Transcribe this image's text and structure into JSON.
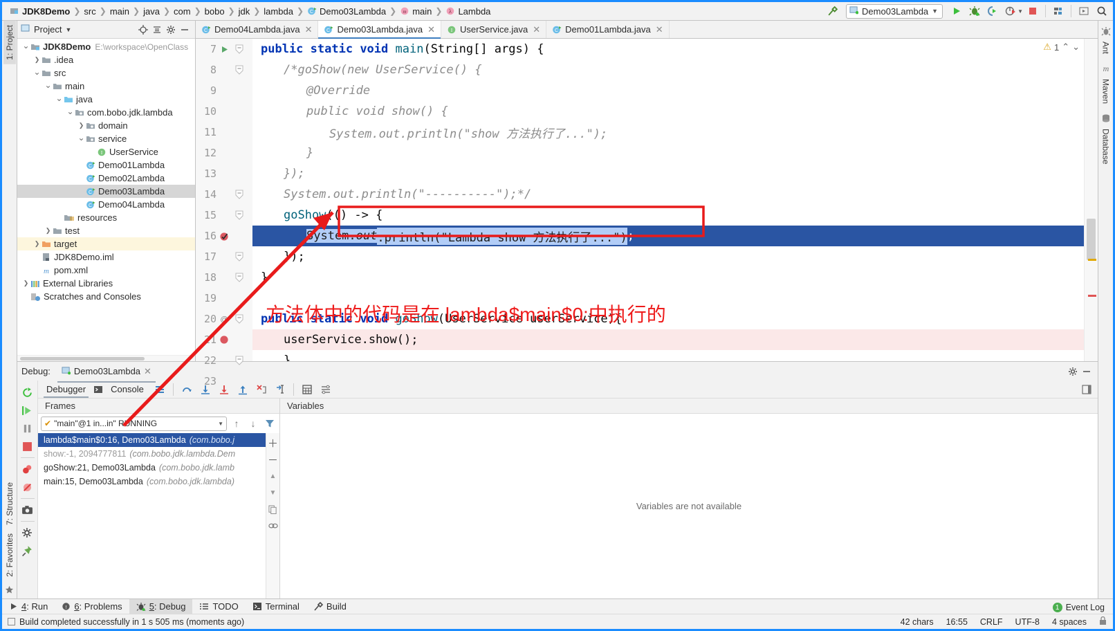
{
  "window": {
    "accent": "#1a8cff"
  },
  "breadcrumb": {
    "items": [
      {
        "label": "JDK8Demo",
        "icon": "project-icon",
        "bold": true
      },
      {
        "label": "src",
        "icon": ""
      },
      {
        "label": "main",
        "icon": ""
      },
      {
        "label": "java",
        "icon": ""
      },
      {
        "label": "com",
        "icon": ""
      },
      {
        "label": "bobo",
        "icon": ""
      },
      {
        "label": "jdk",
        "icon": ""
      },
      {
        "label": "lambda",
        "icon": ""
      },
      {
        "label": "Demo03Lambda",
        "icon": "class-icon"
      },
      {
        "label": "main",
        "icon": "method-icon"
      },
      {
        "label": "Lambda",
        "icon": "lambda-icon"
      }
    ]
  },
  "toolbar": {
    "build_label": "build-hammer-icon",
    "run_config": "Demo03Lambda",
    "run_label": "run-icon",
    "debug_label": "debug-icon",
    "run_coverage_label": "run-with-coverage-icon",
    "profiler_label": "profiler-icon",
    "stop_label": "stop-icon",
    "structure_label": "app-structure-icon",
    "updates_label": "updates-icon",
    "search_label": "search-icon"
  },
  "left_rail": {
    "top": [
      {
        "label": "1: Project",
        "selected": true
      }
    ],
    "bottom": [
      {
        "label": "7: Structure"
      },
      {
        "label": "2: Favorites"
      }
    ]
  },
  "right_rail": {
    "items": [
      {
        "label": "Ant",
        "icon": "ant-icon"
      },
      {
        "label": "Maven",
        "icon": "maven-icon"
      },
      {
        "label": "Database",
        "icon": "database-icon"
      }
    ]
  },
  "project_panel": {
    "title": "Project",
    "tree": [
      {
        "indent": 0,
        "arrow": "v",
        "icon": "module-icon",
        "label": "JDK8Demo",
        "bold": true,
        "path": "E:\\workspace\\OpenClass"
      },
      {
        "indent": 1,
        "arrow": ">",
        "icon": "folder-icon",
        "label": ".idea"
      },
      {
        "indent": 1,
        "arrow": "v",
        "icon": "folder-icon",
        "label": "src"
      },
      {
        "indent": 2,
        "arrow": "v",
        "icon": "folder-icon",
        "label": "main"
      },
      {
        "indent": 3,
        "arrow": "v",
        "icon": "source-folder-icon",
        "label": "java"
      },
      {
        "indent": 4,
        "arrow": "v",
        "icon": "package-icon",
        "label": "com.bobo.jdk.lambda"
      },
      {
        "indent": 5,
        "arrow": ">",
        "icon": "package-icon",
        "label": "domain"
      },
      {
        "indent": 5,
        "arrow": "v",
        "icon": "package-icon",
        "label": "service"
      },
      {
        "indent": 6,
        "arrow": "",
        "icon": "interface-icon",
        "label": "UserService"
      },
      {
        "indent": 5,
        "arrow": "",
        "icon": "class-icon",
        "label": "Demo01Lambda"
      },
      {
        "indent": 5,
        "arrow": "",
        "icon": "class-icon",
        "label": "Demo02Lambda"
      },
      {
        "indent": 5,
        "arrow": "",
        "icon": "class-icon",
        "label": "Demo03Lambda",
        "selected": true
      },
      {
        "indent": 5,
        "arrow": "",
        "icon": "class-icon",
        "label": "Demo04Lambda"
      },
      {
        "indent": 3,
        "arrow": "",
        "icon": "resources-folder-icon",
        "label": "resources"
      },
      {
        "indent": 2,
        "arrow": ">",
        "icon": "folder-icon",
        "label": "test"
      },
      {
        "indent": 1,
        "arrow": ">",
        "icon": "target-folder-icon",
        "label": "target",
        "highlight": true
      },
      {
        "indent": 1,
        "arrow": "",
        "icon": "iml-file-icon",
        "label": "JDK8Demo.iml"
      },
      {
        "indent": 1,
        "arrow": "",
        "icon": "maven-file-icon",
        "label": "pom.xml"
      },
      {
        "indent": 0,
        "arrow": ">",
        "icon": "libraries-icon",
        "label": "External Libraries"
      },
      {
        "indent": 0,
        "arrow": "",
        "icon": "scratches-icon",
        "label": "Scratches and Consoles"
      }
    ]
  },
  "editor": {
    "tabs": [
      {
        "label": "Demo04Lambda.java",
        "icon": "class-icon",
        "active": false
      },
      {
        "label": "Demo03Lambda.java",
        "icon": "class-icon",
        "active": true
      },
      {
        "label": "UserService.java",
        "icon": "interface-icon",
        "active": false
      },
      {
        "label": "Demo01Lambda.java",
        "icon": "class-icon",
        "active": false
      }
    ],
    "inspection_count": "1",
    "lines": [
      {
        "num": "7",
        "gutter": "run-gutter-icon",
        "fold": "-",
        "indent": 0,
        "tokens": [
          {
            "t": "public ",
            "c": "k"
          },
          {
            "t": "static ",
            "c": "k"
          },
          {
            "t": "void ",
            "c": "k"
          },
          {
            "t": "main",
            "c": "mth"
          },
          {
            "t": "(String[] args) {",
            "c": "plain"
          }
        ]
      },
      {
        "num": "8",
        "gutter": "",
        "fold": "-",
        "indent": 1,
        "tokens": [
          {
            "t": "/*goShow(new UserService() {",
            "c": "cmt"
          }
        ]
      },
      {
        "num": "9",
        "gutter": "",
        "fold": "",
        "indent": 2,
        "tokens": [
          {
            "t": "@Override",
            "c": "cmt"
          }
        ]
      },
      {
        "num": "10",
        "gutter": "",
        "fold": "",
        "indent": 2,
        "tokens": [
          {
            "t": "public void show() {",
            "c": "cmt"
          }
        ]
      },
      {
        "num": "11",
        "gutter": "",
        "fold": "",
        "indent": 3,
        "tokens": [
          {
            "t": "System.out.println(\"show 方法执行了...\");",
            "c": "cmt"
          }
        ]
      },
      {
        "num": "12",
        "gutter": "",
        "fold": "",
        "indent": 2,
        "tokens": [
          {
            "t": "}",
            "c": "cmt"
          }
        ]
      },
      {
        "num": "13",
        "gutter": "",
        "fold": "",
        "indent": 1,
        "tokens": [
          {
            "t": "});",
            "c": "cmt"
          }
        ]
      },
      {
        "num": "14",
        "gutter": "",
        "fold": "-",
        "indent": 1,
        "tokens": [
          {
            "t": "System.out.println(\"----------\");*/",
            "c": "cmt"
          }
        ]
      },
      {
        "num": "15",
        "gutter": "",
        "fold": "-",
        "indent": 1,
        "tokens": [
          {
            "t": "goShow",
            "c": "mth"
          },
          {
            "t": "(() -> {",
            "c": "plain"
          }
        ]
      },
      {
        "num": "16",
        "gutter": "breakpoint-done-icon",
        "fold": "",
        "indent": 2,
        "exec": true,
        "bulb": true,
        "tokens": [
          {
            "t": "System.",
            "c": "sel-txt"
          },
          {
            "t": "out",
            "c": "sel-txt i"
          },
          {
            "t": ".println(\"Lambda show 方法执行了...\")",
            "c": "sel-txt"
          },
          {
            "t": ";",
            "c": "caret"
          }
        ]
      },
      {
        "num": "17",
        "gutter": "",
        "fold": "-",
        "indent": 1,
        "tokens": [
          {
            "t": "});",
            "c": "plain"
          }
        ]
      },
      {
        "num": "18",
        "gutter": "",
        "fold": "-",
        "indent": 0,
        "tokens": [
          {
            "t": "}",
            "c": "plain"
          }
        ]
      },
      {
        "num": "19",
        "gutter": "",
        "fold": "",
        "indent": 0,
        "tokens": []
      },
      {
        "num": "20",
        "gutter": "usage-icon",
        "fold": "-",
        "indent": 0,
        "tokens": [
          {
            "t": "public ",
            "c": "k"
          },
          {
            "t": "static ",
            "c": "k"
          },
          {
            "t": "void ",
            "c": "k"
          },
          {
            "t": "goShow",
            "c": "mth"
          },
          {
            "t": "(UserService userService){",
            "c": "plain"
          }
        ]
      },
      {
        "num": "21",
        "gutter": "breakpoint-icon",
        "fold": "",
        "indent": 1,
        "bpline": true,
        "tokens": [
          {
            "t": "userService.show();",
            "c": "plain"
          }
        ]
      },
      {
        "num": "22",
        "gutter": "",
        "fold": "-",
        "indent": 1,
        "tokens": [
          {
            "t": "}",
            "c": "plain"
          }
        ]
      },
      {
        "num": "23",
        "gutter": "",
        "fold": "",
        "indent": 0,
        "tokens": [
          {
            "t": "}",
            "c": "plain"
          }
        ]
      }
    ]
  },
  "annotation": {
    "text": "方法体中的代码是在 lambda$main$0:中执行的",
    "color": "#ee1c1c"
  },
  "debug_panel": {
    "label": "Debug:",
    "session": "Demo03Lambda",
    "tabs": [
      {
        "label": "Debugger",
        "icon": "debugger-icon",
        "active": true
      },
      {
        "label": "Console",
        "icon": "console-icon",
        "active": false
      }
    ],
    "frames": {
      "title": "Frames",
      "thread": "\"main\"@1 in...in\" RUNNING",
      "items": [
        {
          "label": "lambda$main$0:16, Demo03Lambda",
          "pkg": "(com.bobo.j",
          "selected": true
        },
        {
          "label": "show:-1, 2094777811",
          "pkg": "(com.bobo.jdk.lambda.Dem",
          "dim": true
        },
        {
          "label": "goShow:21, Demo03Lambda",
          "pkg": "(com.bobo.jdk.lamb"
        },
        {
          "label": "main:15, Demo03Lambda",
          "pkg": "(com.bobo.jdk.lambda)"
        }
      ]
    },
    "variables": {
      "title": "Variables",
      "empty_message": "Variables are not available"
    }
  },
  "bottom_bar": {
    "items": [
      {
        "label": "4: Run",
        "mnemonic": "4",
        "icon": "run-icon",
        "selected": false
      },
      {
        "label": "6: Problems",
        "mnemonic": "6",
        "icon": "problems-icon",
        "selected": false
      },
      {
        "label": "5: Debug",
        "mnemonic": "5",
        "icon": "debug-icon",
        "selected": true
      },
      {
        "label": "TODO",
        "mnemonic": "",
        "icon": "todo-icon",
        "selected": false
      },
      {
        "label": "Terminal",
        "mnemonic": "",
        "icon": "terminal-icon",
        "selected": false
      },
      {
        "label": "Build",
        "mnemonic": "",
        "icon": "build-icon",
        "selected": false
      }
    ]
  },
  "status_bar": {
    "message": "Build completed successfully in 1 s 505 ms (moments ago)",
    "chars": "42 chars",
    "position": "16:55",
    "line_sep": "CRLF",
    "encoding": "UTF-8",
    "indent": "4 spaces",
    "event_log": "Event Log",
    "event_count": "1"
  }
}
